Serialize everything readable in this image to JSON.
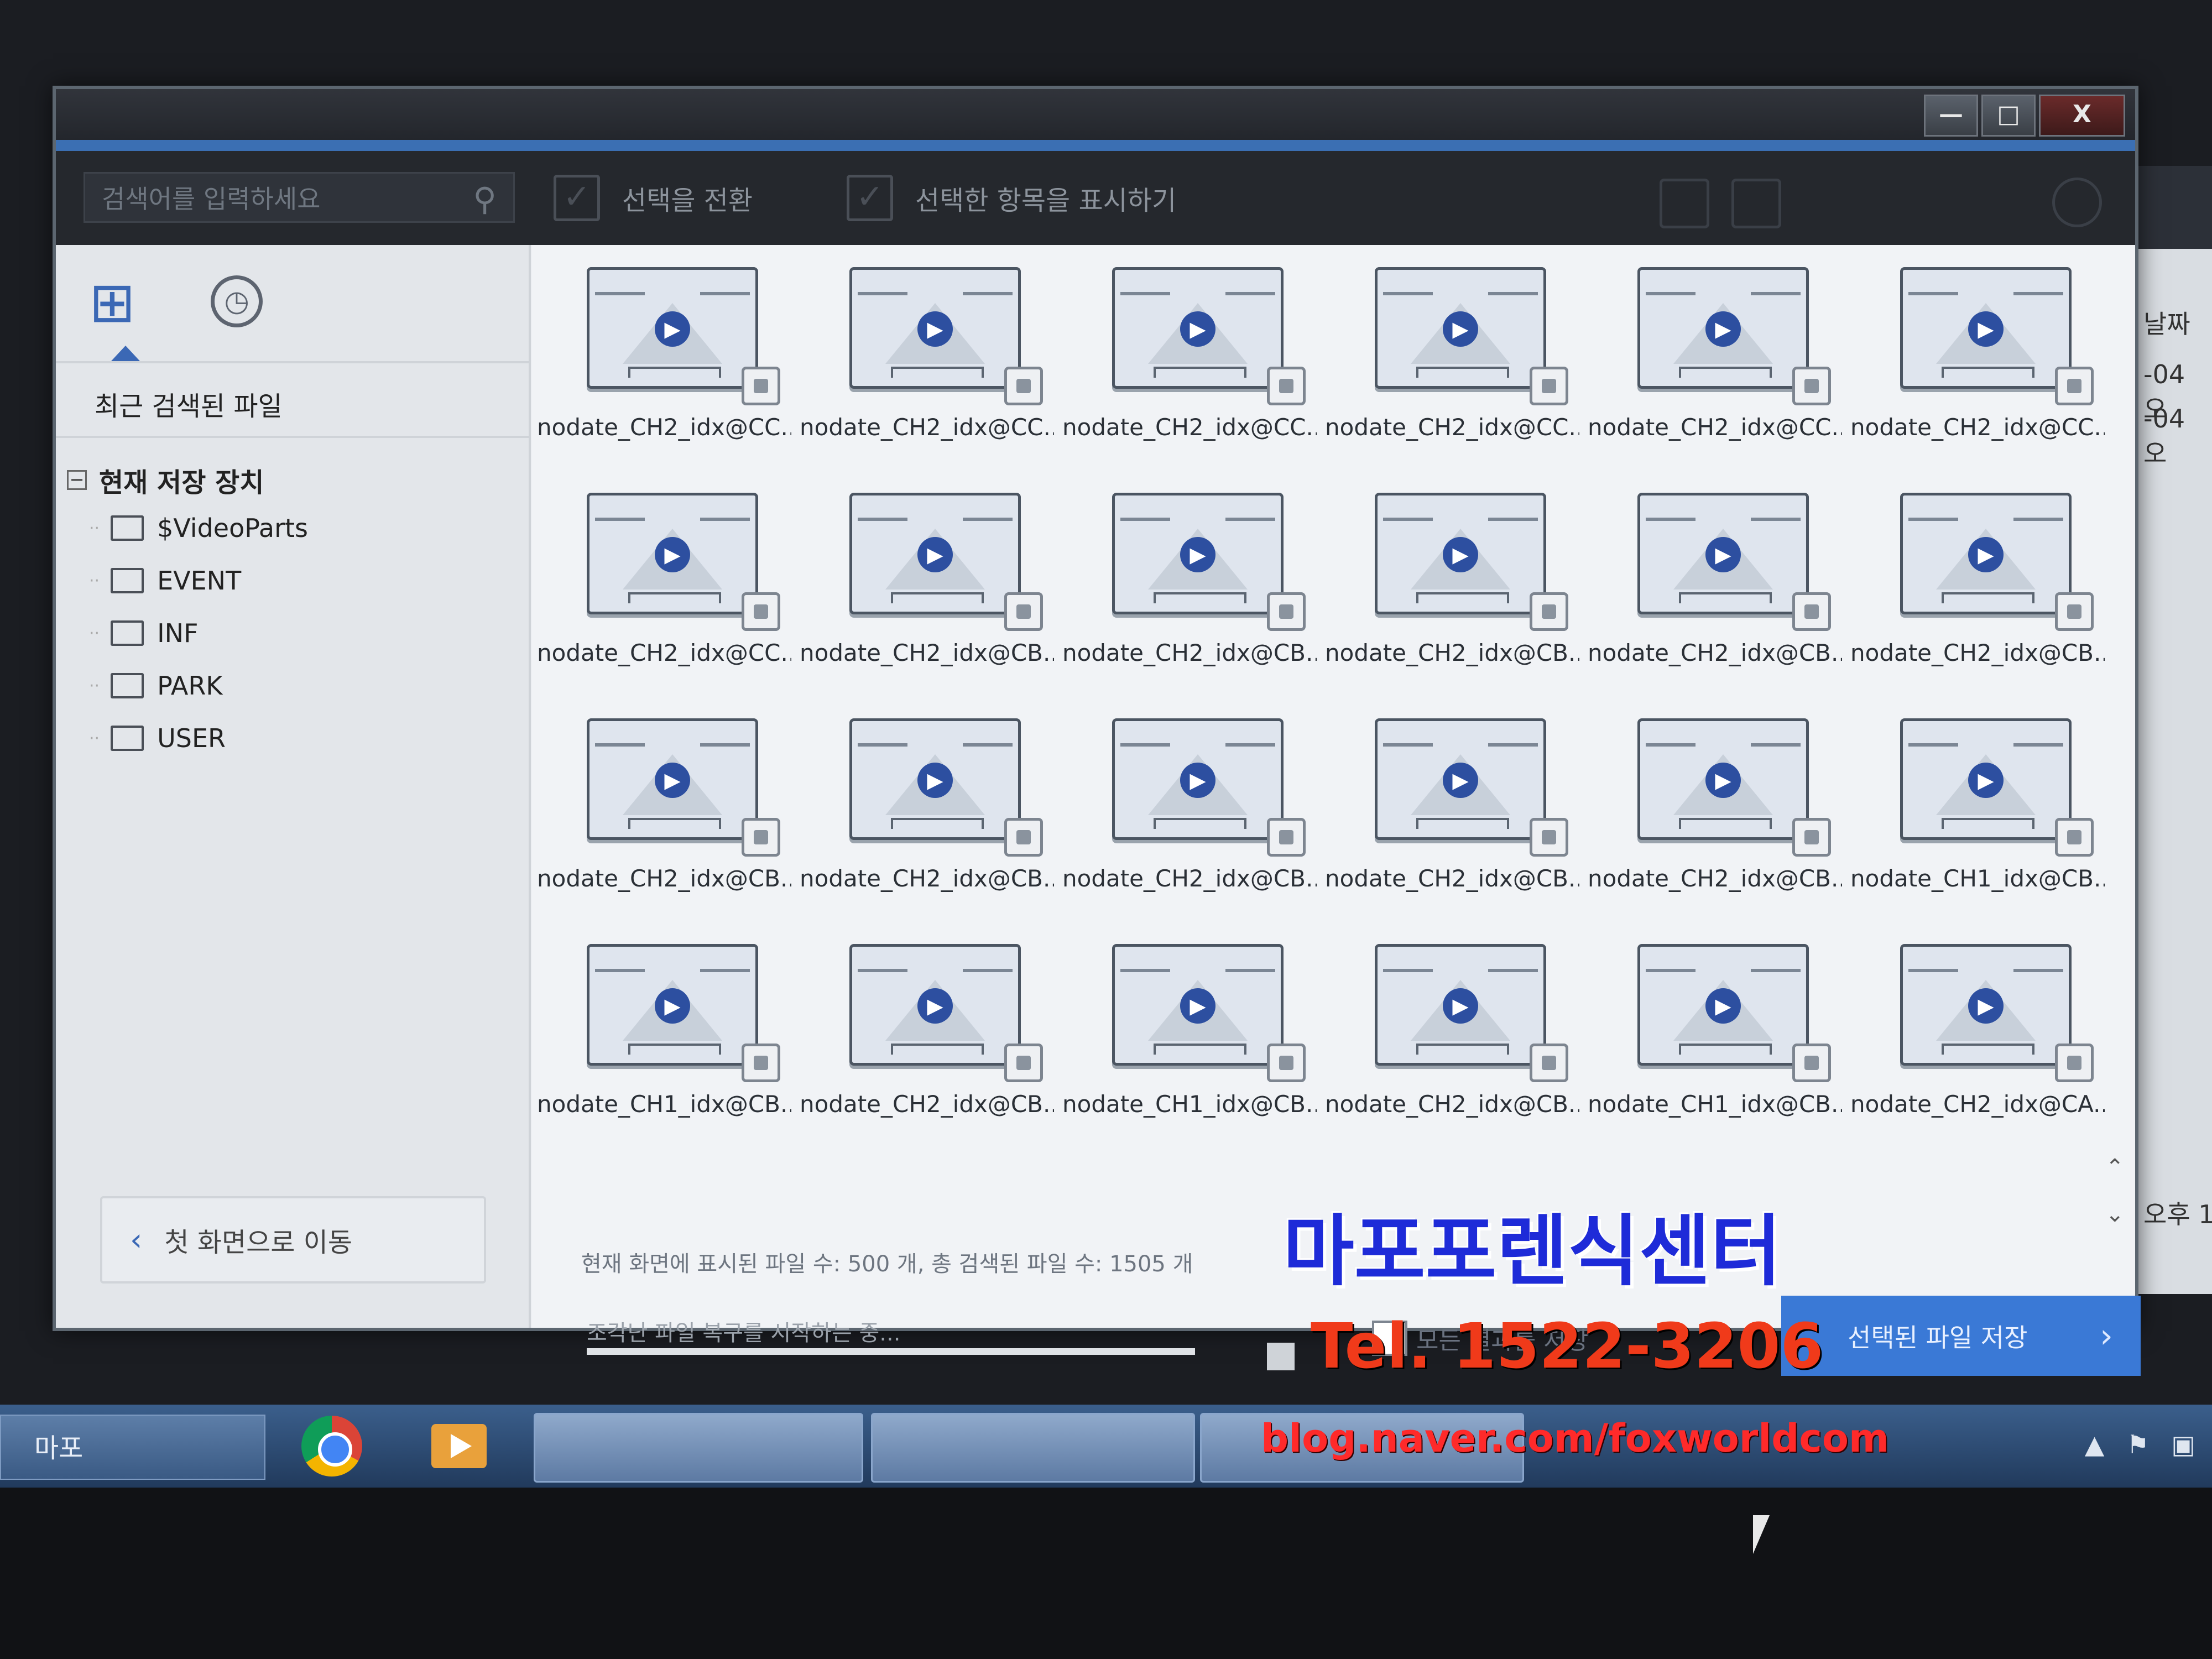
{
  "window": {
    "title": "",
    "controls": [
      "—",
      "□",
      "X"
    ]
  },
  "toolbar": {
    "search_placeholder": "검색어를 입력하세요",
    "select_toggle": "선택을 전환",
    "show_selected": "선택한 항목을 표시하기"
  },
  "sidebar": {
    "recent": "최근 검색된 파일",
    "storage": "현재 저장 장치",
    "folders": [
      "$VideoParts",
      "EVENT",
      "INF",
      "PARK",
      "USER"
    ],
    "back": "첫 화면으로 이동"
  },
  "files": [
    [
      "nodate_CH2_idx@CC...",
      "nodate_CH2_idx@CC...",
      "nodate_CH2_idx@CC...",
      "nodate_CH2_idx@CC...",
      "nodate_CH2_idx@CC...",
      "nodate_CH2_idx@CC..."
    ],
    [
      "nodate_CH2_idx@CC...",
      "nodate_CH2_idx@CB...",
      "nodate_CH2_idx@CB...",
      "nodate_CH2_idx@CB...",
      "nodate_CH2_idx@CB...",
      "nodate_CH2_idx@CB..."
    ],
    [
      "nodate_CH2_idx@CB...",
      "nodate_CH2_idx@CB...",
      "nodate_CH2_idx@CB...",
      "nodate_CH2_idx@CB...",
      "nodate_CH2_idx@CB...",
      "nodate_CH1_idx@CB..."
    ],
    [
      "nodate_CH1_idx@CB...",
      "nodate_CH2_idx@CB...",
      "nodate_CH1_idx@CB...",
      "nodate_CH2_idx@CB...",
      "nodate_CH1_idx@CB...",
      "nodate_CH2_idx@CA..."
    ]
  ],
  "status": "현재 화면에 표시된 파일 수: 500 개,  총 검색된 파일 수: 1505 개",
  "progress": {
    "text": "조각난 파일 복구를 시작하는 중...",
    "fraction": 0.0
  },
  "actions": {
    "result_label": "모든 결과를 저장",
    "save_label": "선택된 파일 저장"
  },
  "background_window": {
    "column_header": "날짜",
    "rows": [
      "-04 오",
      "-04 오"
    ],
    "bottom": "오후 1"
  },
  "watermark": {
    "title": "마포포렌식센터",
    "tel": "Tel. 1522-3206",
    "blog": "blog.naver.com/foxworldcom"
  },
  "taskbar": {
    "start_label": "마포"
  },
  "colors": {
    "accent": "#3a79d6",
    "title_bar": "#23262c",
    "watermark_blue": "#1e2bd8",
    "watermark_red": "#f03a1a"
  }
}
